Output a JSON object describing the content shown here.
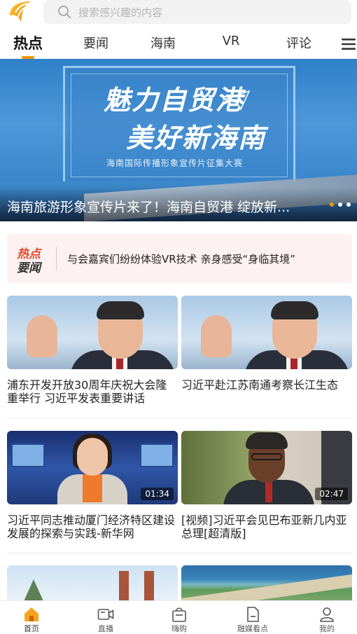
{
  "search": {
    "placeholder": "搜索感兴趣的内容"
  },
  "tabs": [
    {
      "label": "热点",
      "active": true
    },
    {
      "label": "要闻",
      "active": false
    },
    {
      "label": "海南",
      "active": false
    },
    {
      "label": "VR",
      "active": false
    },
    {
      "label": "评论",
      "active": false
    }
  ],
  "banner": {
    "headline_line1": "魅力自贸港",
    "headline_line2": "美好新海南",
    "subtitle": "海南国际传播形象宣传片征集大赛",
    "caption": "海南旅游形象宣传片来了！海南自贸港 绽放新...",
    "slide_count": 3,
    "active_slide": 1
  },
  "hot_news": {
    "logo_top": "热点",
    "logo_bottom": "要闻",
    "text": "与会嘉宾们纷纷体验VR技术 亲身感受“身临其境”"
  },
  "cards": [
    {
      "title": "浦东开发开放30周年庆祝大会隆重举行 习近平发表重要讲话",
      "duration": ""
    },
    {
      "title": "习近平赴江苏南通考察长江生态",
      "duration": ""
    },
    {
      "title": "习近平同志推动厦门经济特区建设发展的探索与实践-新华网",
      "duration": "01:34"
    },
    {
      "title": "[视频]习近平会见巴布亚新几内亚总理[超清版]",
      "duration": "02:47"
    }
  ],
  "bottom_nav": [
    {
      "label": "首页",
      "icon": "home-icon",
      "active": true
    },
    {
      "label": "直播",
      "icon": "live-video-icon",
      "active": false
    },
    {
      "label": "嗨购",
      "icon": "shopping-bag-icon",
      "active": false
    },
    {
      "label": "融媒看点",
      "icon": "document-icon",
      "active": false
    },
    {
      "label": "我的",
      "icon": "user-icon",
      "active": false
    }
  ],
  "colors": {
    "accent": "#f39800",
    "hot_red": "#e8472b",
    "hot_bg": "#fdf1f1"
  }
}
